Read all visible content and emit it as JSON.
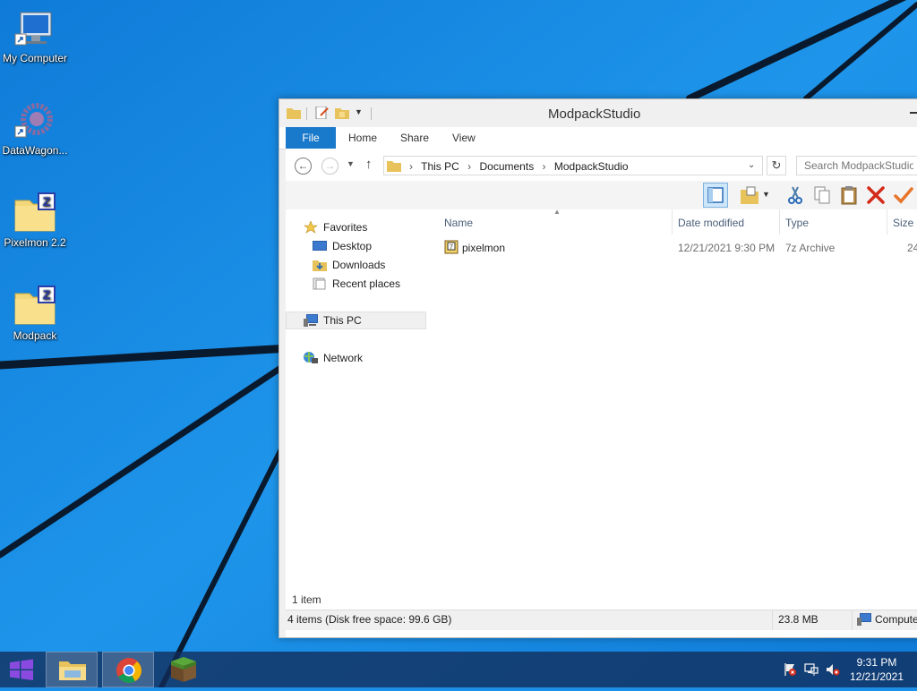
{
  "desktop": {
    "icons": [
      {
        "label": "My Computer",
        "icon": "computer-icon"
      },
      {
        "label": "DataWagon...",
        "icon": "gear-icon"
      },
      {
        "label": "Pixelmon 2.2",
        "icon": "zip-folder-icon"
      },
      {
        "label": "Modpack",
        "icon": "zip-folder-icon"
      }
    ]
  },
  "explorer": {
    "title": "ModpackStudio",
    "ribbon": {
      "tabs": [
        "File",
        "Home",
        "Share",
        "View"
      ]
    },
    "address": {
      "crumbs": [
        "This PC",
        "Documents",
        "ModpackStudio"
      ],
      "search_placeholder": "Search ModpackStudio"
    },
    "nav": {
      "favorites": "Favorites",
      "desktop": "Desktop",
      "downloads": "Downloads",
      "recent": "Recent places",
      "this_pc": "This PC",
      "network": "Network"
    },
    "columns": {
      "name": "Name",
      "date": "Date modified",
      "type": "Type",
      "size": "Size"
    },
    "files": [
      {
        "name": "pixelmon",
        "date": "12/21/2021 9:30 PM",
        "type": "7z Archive",
        "size": "24"
      }
    ],
    "item_count": "1 item",
    "status": {
      "items": "4 items (Disk free space: 99.6 GB)",
      "size": "23.8 MB",
      "location": "Compute"
    }
  },
  "taskbar": {
    "time": "9:31 PM",
    "date": "12/21/2021"
  },
  "colors": {
    "wallpaper": "#1e8fe6",
    "accent": "#1979ca",
    "taskbar": "#122d5a"
  }
}
